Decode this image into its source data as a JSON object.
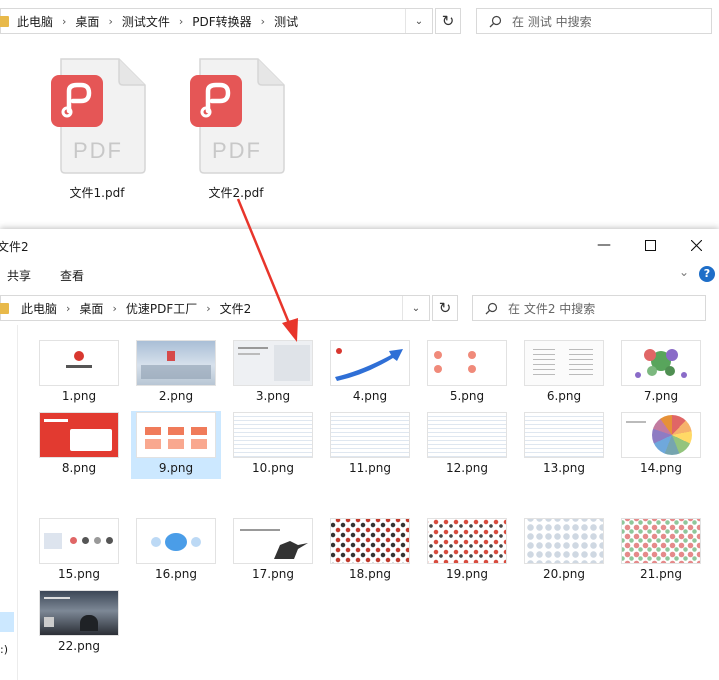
{
  "top_window": {
    "breadcrumb": [
      "此电脑",
      "桌面",
      "测试文件",
      "PDF转换器",
      "测试"
    ],
    "search_placeholder": "在 测试 中搜索",
    "files": [
      "文件1.pdf",
      "文件2.pdf"
    ],
    "pdf_badge": "PDF",
    "accent": "#e55656"
  },
  "bottom_window": {
    "title": "文件2",
    "ribbon_tabs": [
      "共享",
      "查看"
    ],
    "breadcrumb": [
      "此电脑",
      "桌面",
      "优速PDF工厂",
      "文件2"
    ],
    "search_placeholder": "在 文件2 中搜索",
    "files": [
      "1.png",
      "2.png",
      "3.png",
      "4.png",
      "5.png",
      "6.png",
      "7.png",
      "8.png",
      "9.png",
      "10.png",
      "11.png",
      "12.png",
      "13.png",
      "14.png",
      "15.png",
      "16.png",
      "17.png",
      "18.png",
      "19.png",
      "20.png",
      "21.png",
      "22.png"
    ],
    "selected_file": "9.png",
    "nav_label": ":)"
  },
  "arrow_color": "#e8352b",
  "selection_color": "#cce8ff"
}
